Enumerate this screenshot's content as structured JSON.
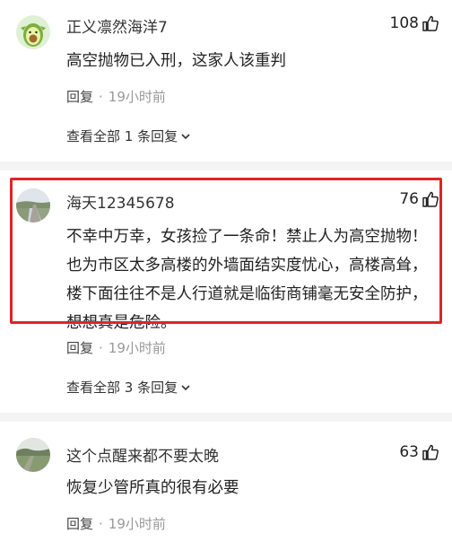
{
  "comments": [
    {
      "username": "正义凛然海洋7",
      "likes": "108",
      "text": "高空抛物已入刑，这家人该重判",
      "reply_label": "回复",
      "separator": "·",
      "time": "19小时前",
      "view_all": "查看全部 1 条回复"
    },
    {
      "username": "海天12345678",
      "likes": "76",
      "text": "不幸中万幸，女孩捡了一条命！禁止人为高空抛物！也为市区太多高楼的外墙面结实度忧心，高楼高耸，楼下面往往不是人行道就是临街商铺毫无安全防护，想想真是危险。",
      "reply_label": "回复",
      "separator": "·",
      "time": "19小时前",
      "view_all": "查看全部 3 条回复"
    },
    {
      "username": "这个点醒来都不要太晚",
      "likes": "63",
      "text": "恢复少管所真的很有必要",
      "reply_label": "回复",
      "separator": "·",
      "time": "19小时前"
    }
  ],
  "colors": {
    "highlight_border": "#e02424",
    "divider": "#f4f4f4",
    "muted_text": "#999999"
  }
}
